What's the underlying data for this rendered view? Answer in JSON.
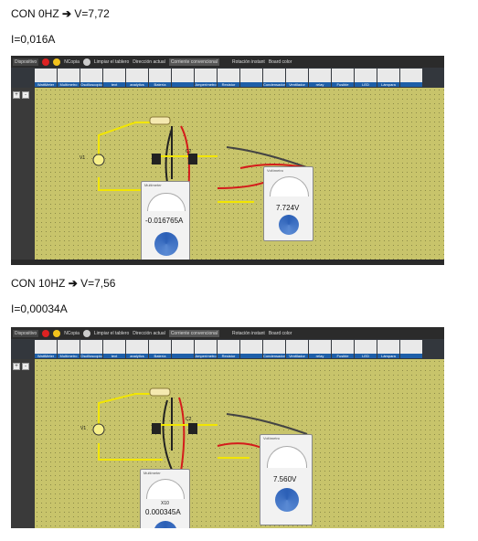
{
  "section1": {
    "heading_prefix": "CON 0HZ",
    "arrow": "➔",
    "heading_value": "V=7,72",
    "current": "I=0,016A",
    "screenshot": {
      "toolbar": {
        "dispositivo": "Dispositivo",
        "ncopia": "NCopia",
        "limpiar": "Limpiar el tablero",
        "direccion": "Dirección actual",
        "corriente": "Corriente convencional",
        "rotacion": "Rotación instant",
        "board_color": "Board color"
      },
      "tools": [
        "WattMeter",
        "Multímetro",
        "Oscilloscopio",
        "text",
        "analytics",
        "Batería",
        "",
        "Amperímetro",
        "Resistor",
        "",
        "Condensador",
        "Ventilador",
        "relay",
        "Fusible",
        "LED",
        "Lámpara",
        ""
      ],
      "multimeter_title": "Multimeter",
      "multimeter_value": "-0.016765A",
      "voltmeter_title": "Voltímetro",
      "voltmeter_value": "7.724V",
      "source_label": "V1",
      "wire_label": "C2"
    }
  },
  "section2": {
    "heading_prefix": "CON 10HZ",
    "arrow": "➔",
    "heading_value": "V=7,56",
    "current": "I=0,00034A",
    "screenshot": {
      "toolbar": {
        "dispositivo": "Dispositivo",
        "ncopia": "NCopia",
        "limpiar": "Limpiar el tablero",
        "direccion": "Dirección actual",
        "corriente": "Corriente convencional",
        "rotacion": "Rotación instant",
        "board_color": "Board color"
      },
      "tools": [
        "WattMeter",
        "Multímetro",
        "Oscilloscopio",
        "text",
        "analytics",
        "Batería",
        "",
        "Amperímetro",
        "Resistor",
        "",
        "Condensador",
        "Ventilador",
        "relay",
        "Fusible",
        "LED",
        "Lámpara",
        ""
      ],
      "multimeter_title": "Multimeter",
      "multimeter_scale": "X10",
      "multimeter_value": "0.000345A",
      "voltmeter_title": "Voltímetro",
      "voltmeter_value": "7.560V",
      "source_label": "V1",
      "wire_label": "C2"
    }
  }
}
